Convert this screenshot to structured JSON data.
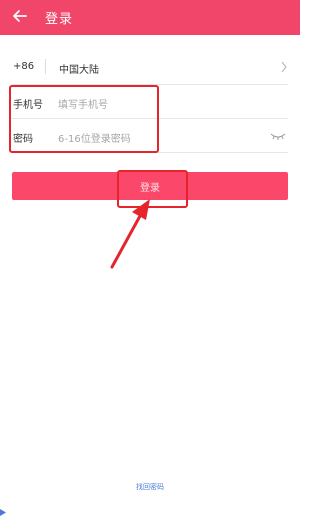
{
  "colors": {
    "brand": "#f2456a",
    "button": "#fb4769",
    "annotation": "#e5242b",
    "link": "#4a7bd8"
  },
  "header": {
    "back_icon": "arrow-left-icon",
    "title": "登录"
  },
  "form": {
    "country": {
      "code": "+86",
      "name": "中国大陆",
      "icon": "chevron-right-icon"
    },
    "phone": {
      "label": "手机号",
      "placeholder": "填写手机号"
    },
    "password": {
      "label": "密码",
      "placeholder": "6-16位登录密码",
      "icon": "eye-closed-icon"
    }
  },
  "login_button": {
    "label": "登录"
  },
  "forgot_password": "找回密码"
}
